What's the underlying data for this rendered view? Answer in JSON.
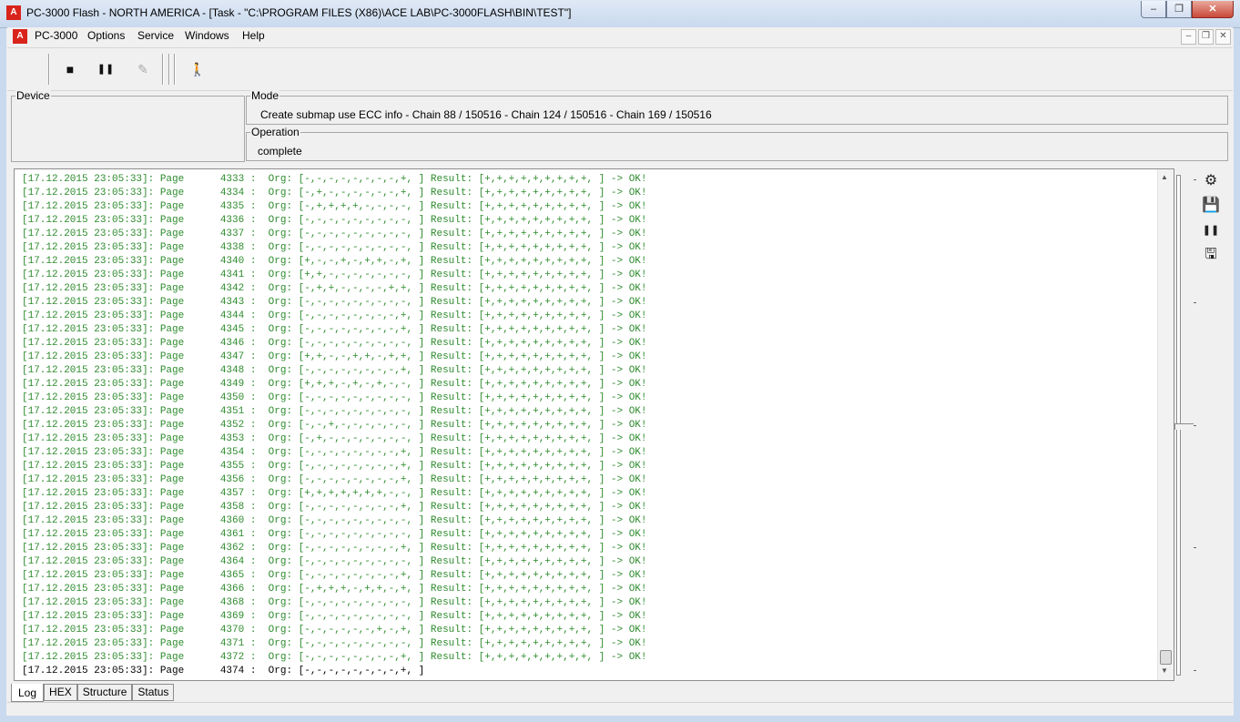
{
  "window": {
    "title": "PC-3000 Flash  - NORTH AMERICA - [Task - \"C:\\PROGRAM FILES (X86)\\ACE LAB\\PC-3000FLASH\\BIN\\TEST\"]",
    "minimize": "–",
    "maximize": "❐",
    "close": "✕"
  },
  "menu": {
    "items": [
      "PC-3000",
      "Options",
      "Service",
      "Windows",
      "Help"
    ],
    "mdi_minimize": "–",
    "mdi_restore": "❐",
    "mdi_close": "✕"
  },
  "toolbar": {
    "stop_icon": "■",
    "pause_icon": "❚❚",
    "check_icon": "✎",
    "exit_icon": "🚶"
  },
  "device": {
    "label": "Device",
    "value": ""
  },
  "mode": {
    "label": "Mode",
    "value": "Create submap use ECC info - Chain 88 / 150516 - Chain 124 / 150516 - Chain 169 / 150516"
  },
  "operation": {
    "label": "Operation",
    "value": "complete"
  },
  "log": {
    "lines": [
      "[17.12.2015 23:05:33]: Page      4333 :  Org: [-,-,-,-,-,-,-,-,+, ] Result: [+,+,+,+,+,+,+,+,+, ] -> OK!",
      "[17.12.2015 23:05:33]: Page      4334 :  Org: [-,+,-,-,-,-,-,-,+, ] Result: [+,+,+,+,+,+,+,+,+, ] -> OK!",
      "[17.12.2015 23:05:33]: Page      4335 :  Org: [-,+,+,+,+,-,-,-,-, ] Result: [+,+,+,+,+,+,+,+,+, ] -> OK!",
      "[17.12.2015 23:05:33]: Page      4336 :  Org: [-,-,-,-,-,-,-,-,-, ] Result: [+,+,+,+,+,+,+,+,+, ] -> OK!",
      "[17.12.2015 23:05:33]: Page      4337 :  Org: [-,-,-,-,-,-,-,-,-, ] Result: [+,+,+,+,+,+,+,+,+, ] -> OK!",
      "[17.12.2015 23:05:33]: Page      4338 :  Org: [-,-,-,-,-,-,-,-,-, ] Result: [+,+,+,+,+,+,+,+,+, ] -> OK!",
      "[17.12.2015 23:05:33]: Page      4340 :  Org: [+,-,-,+,-,+,+,-,+, ] Result: [+,+,+,+,+,+,+,+,+, ] -> OK!",
      "[17.12.2015 23:05:33]: Page      4341 :  Org: [+,+,-,-,-,-,-,-,-, ] Result: [+,+,+,+,+,+,+,+,+, ] -> OK!",
      "[17.12.2015 23:05:33]: Page      4342 :  Org: [-,+,+,-,-,-,-,+,+, ] Result: [+,+,+,+,+,+,+,+,+, ] -> OK!",
      "[17.12.2015 23:05:33]: Page      4343 :  Org: [-,-,-,-,-,-,-,-,-, ] Result: [+,+,+,+,+,+,+,+,+, ] -> OK!",
      "[17.12.2015 23:05:33]: Page      4344 :  Org: [-,-,-,-,-,-,-,-,+, ] Result: [+,+,+,+,+,+,+,+,+, ] -> OK!",
      "[17.12.2015 23:05:33]: Page      4345 :  Org: [-,-,-,-,-,-,-,-,+, ] Result: [+,+,+,+,+,+,+,+,+, ] -> OK!",
      "[17.12.2015 23:05:33]: Page      4346 :  Org: [-,-,-,-,-,-,-,-,-, ] Result: [+,+,+,+,+,+,+,+,+, ] -> OK!",
      "[17.12.2015 23:05:33]: Page      4347 :  Org: [+,+,-,-,+,+,-,+,+, ] Result: [+,+,+,+,+,+,+,+,+, ] -> OK!",
      "[17.12.2015 23:05:33]: Page      4348 :  Org: [-,-,-,-,-,-,-,-,+, ] Result: [+,+,+,+,+,+,+,+,+, ] -> OK!",
      "[17.12.2015 23:05:33]: Page      4349 :  Org: [+,+,+,-,+,-,+,-,-, ] Result: [+,+,+,+,+,+,+,+,+, ] -> OK!",
      "[17.12.2015 23:05:33]: Page      4350 :  Org: [-,-,-,-,-,-,-,-,-, ] Result: [+,+,+,+,+,+,+,+,+, ] -> OK!",
      "[17.12.2015 23:05:33]: Page      4351 :  Org: [-,-,-,-,-,-,-,-,-, ] Result: [+,+,+,+,+,+,+,+,+, ] -> OK!",
      "[17.12.2015 23:05:33]: Page      4352 :  Org: [-,-,+,-,-,-,-,-,-, ] Result: [+,+,+,+,+,+,+,+,+, ] -> OK!",
      "[17.12.2015 23:05:33]: Page      4353 :  Org: [-,+,-,-,-,-,-,-,-, ] Result: [+,+,+,+,+,+,+,+,+, ] -> OK!",
      "[17.12.2015 23:05:33]: Page      4354 :  Org: [-,-,-,-,-,-,-,-,+, ] Result: [+,+,+,+,+,+,+,+,+, ] -> OK!",
      "[17.12.2015 23:05:33]: Page      4355 :  Org: [-,-,-,-,-,-,-,-,+, ] Result: [+,+,+,+,+,+,+,+,+, ] -> OK!",
      "[17.12.2015 23:05:33]: Page      4356 :  Org: [-,-,-,-,-,-,-,-,+, ] Result: [+,+,+,+,+,+,+,+,+, ] -> OK!",
      "[17.12.2015 23:05:33]: Page      4357 :  Org: [+,+,+,+,+,+,+,-,-, ] Result: [+,+,+,+,+,+,+,+,+, ] -> OK!",
      "[17.12.2015 23:05:33]: Page      4358 :  Org: [-,-,-,-,-,-,-,-,+, ] Result: [+,+,+,+,+,+,+,+,+, ] -> OK!",
      "[17.12.2015 23:05:33]: Page      4360 :  Org: [-,-,-,-,-,-,-,-,-, ] Result: [+,+,+,+,+,+,+,+,+, ] -> OK!",
      "[17.12.2015 23:05:33]: Page      4361 :  Org: [-,-,-,-,-,-,-,-,-, ] Result: [+,+,+,+,+,+,+,+,+, ] -> OK!",
      "[17.12.2015 23:05:33]: Page      4362 :  Org: [-,-,-,-,-,-,-,-,+, ] Result: [+,+,+,+,+,+,+,+,+, ] -> OK!",
      "[17.12.2015 23:05:33]: Page      4364 :  Org: [-,-,-,-,-,-,-,-,-, ] Result: [+,+,+,+,+,+,+,+,+, ] -> OK!",
      "[17.12.2015 23:05:33]: Page      4365 :  Org: [-,-,-,-,-,-,-,-,+, ] Result: [+,+,+,+,+,+,+,+,+, ] -> OK!",
      "[17.12.2015 23:05:33]: Page      4366 :  Org: [-,+,+,+,-,+,+,-,+, ] Result: [+,+,+,+,+,+,+,+,+, ] -> OK!",
      "[17.12.2015 23:05:33]: Page      4368 :  Org: [-,-,-,-,-,-,-,-,-, ] Result: [+,+,+,+,+,+,+,+,+, ] -> OK!",
      "[17.12.2015 23:05:33]: Page      4369 :  Org: [-,-,-,-,-,-,-,-,-, ] Result: [+,+,+,+,+,+,+,+,+, ] -> OK!",
      "[17.12.2015 23:05:33]: Page      4370 :  Org: [-,-,-,-,-,-,+,-,+, ] Result: [+,+,+,+,+,+,+,+,+, ] -> OK!",
      "[17.12.2015 23:05:33]: Page      4371 :  Org: [-,-,-,-,-,-,-,-,-, ] Result: [+,+,+,+,+,+,+,+,+, ] -> OK!",
      "[17.12.2015 23:05:33]: Page      4372 :  Org: [-,-,-,-,-,-,-,-,+, ] Result: [+,+,+,+,+,+,+,+,+, ] -> OK!"
    ],
    "pending_line": "[17.12.2015 23:05:33]: Page      4374 :  Org: [-,-,-,-,-,-,-,-,+, ]",
    "ok_color": "#2e8b2e"
  },
  "side_tools": {
    "settings_icon": "⚙",
    "save_icon": "💾",
    "pause_icon": "❚❚",
    "save_as_icon": "🖫"
  },
  "tabs": [
    "Log",
    "HEX",
    "Structure",
    "Status"
  ],
  "active_tab": "Log"
}
